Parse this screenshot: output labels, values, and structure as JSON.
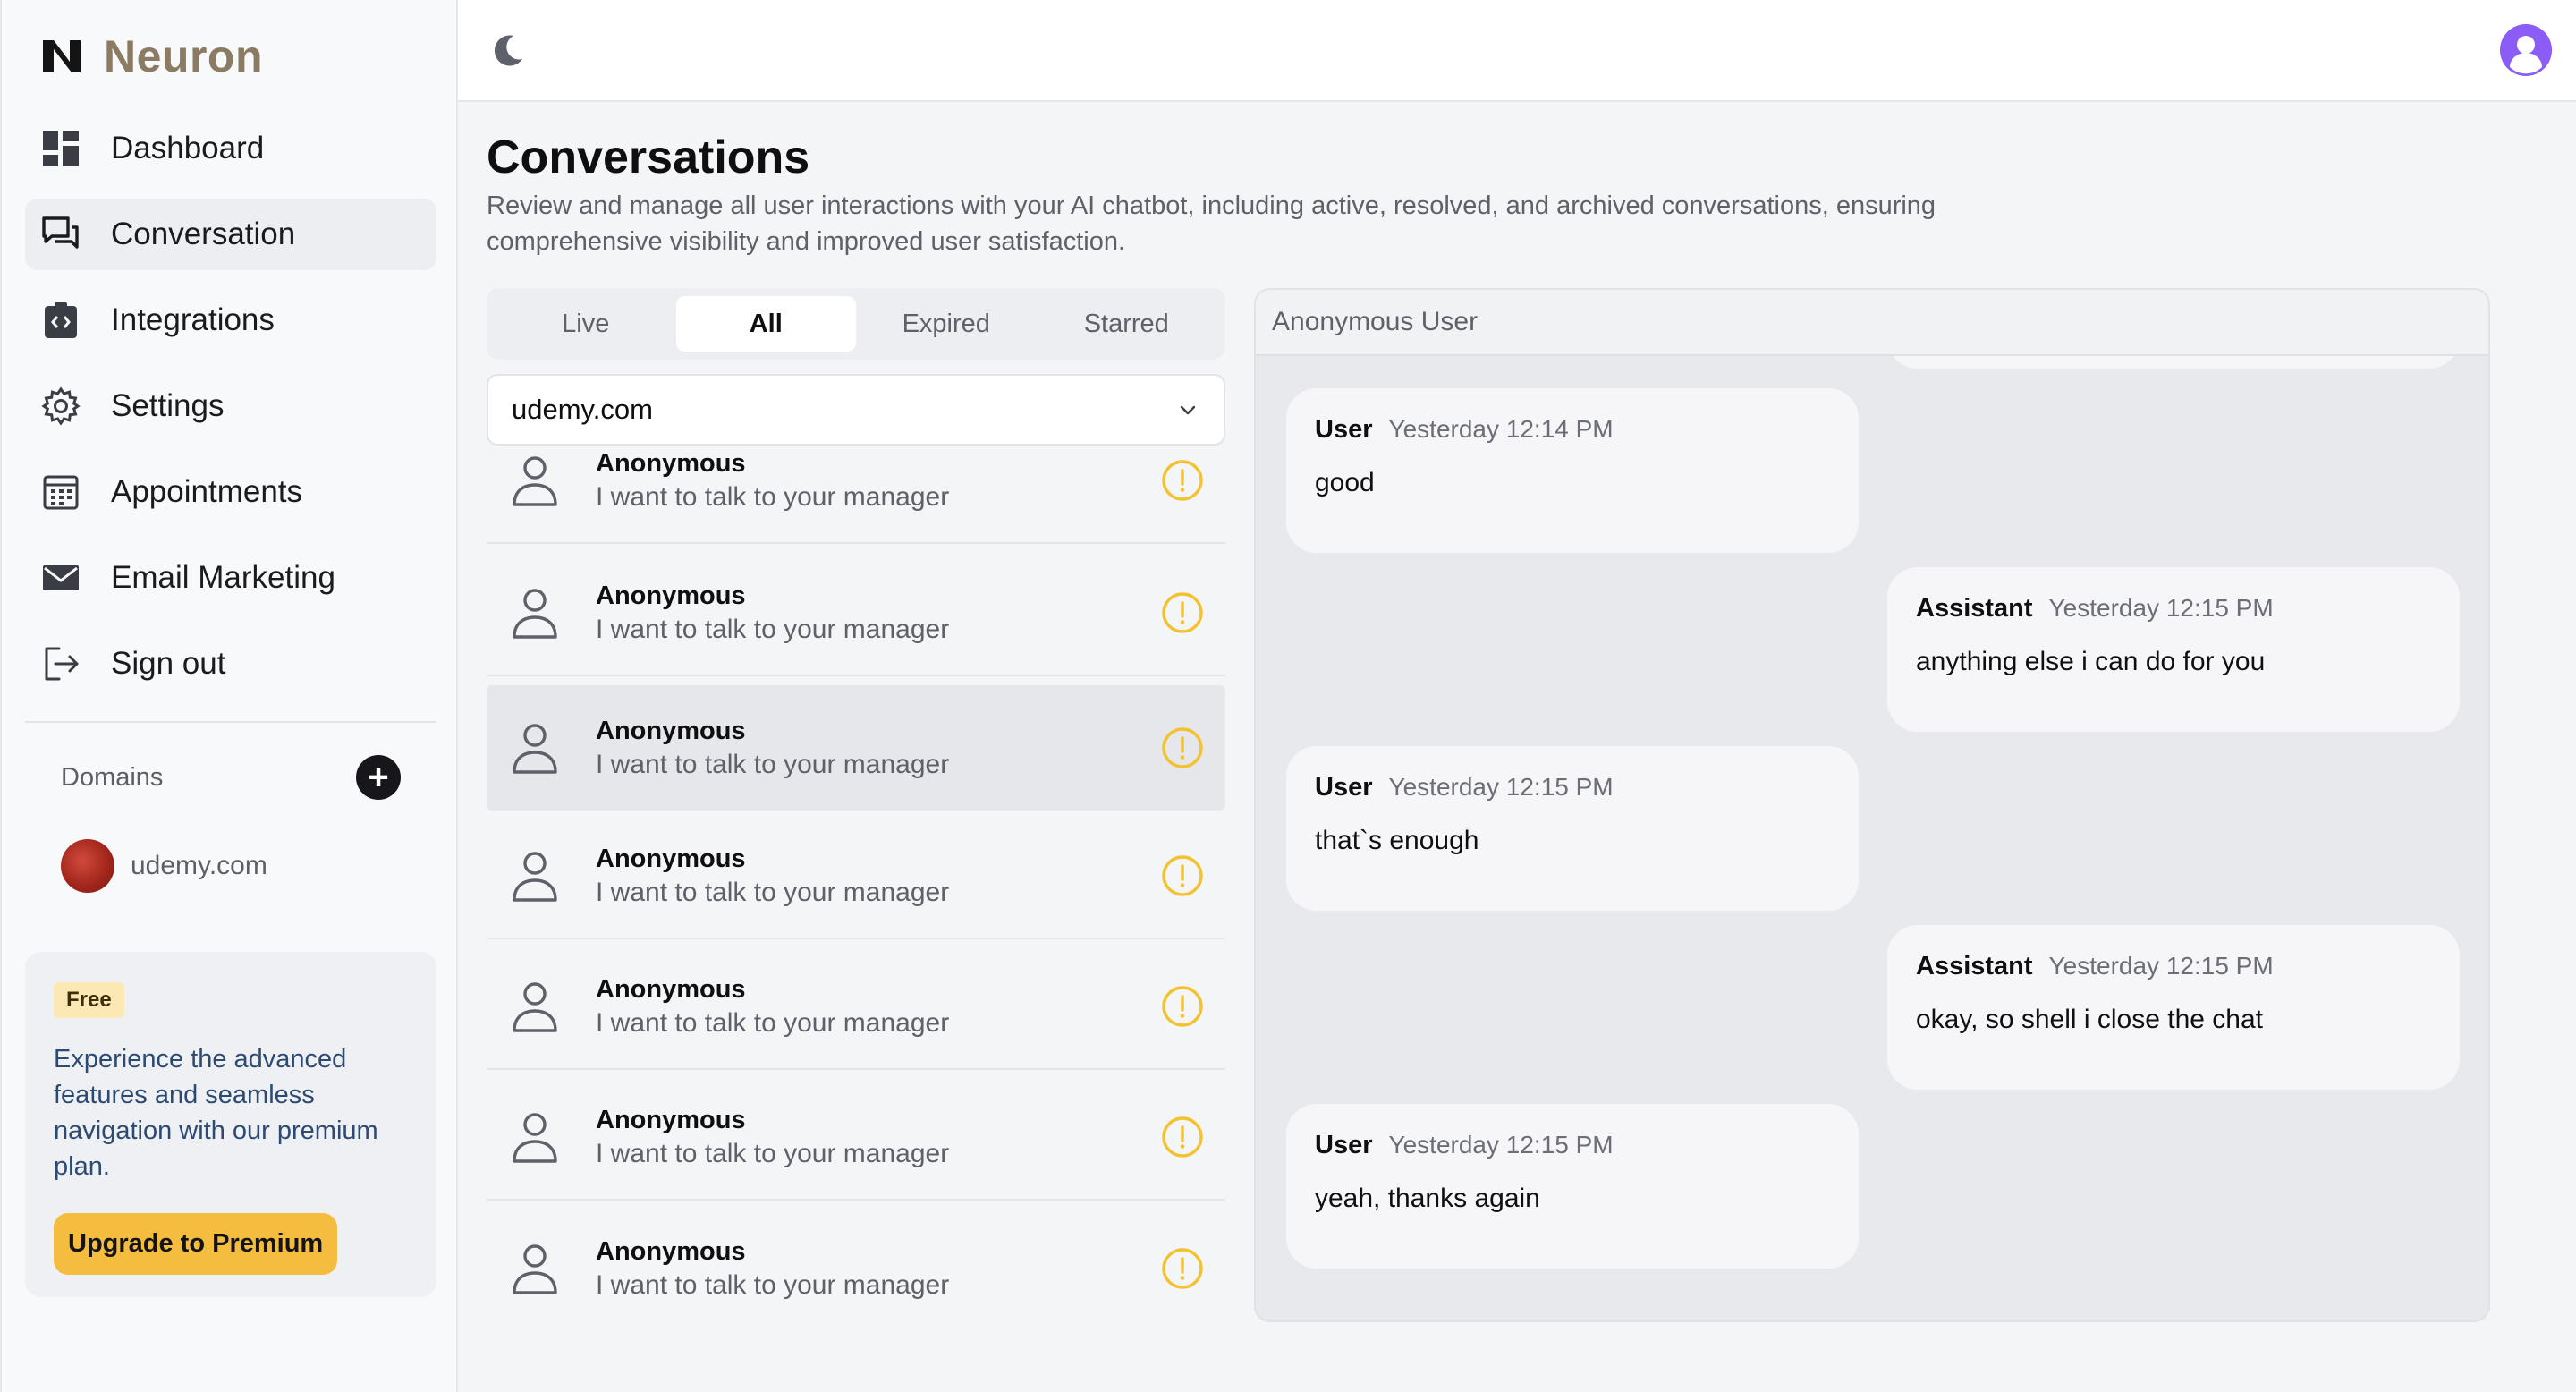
{
  "app": {
    "name": "Neuron"
  },
  "sidebar": {
    "items": [
      {
        "label": "Dashboard",
        "icon": "dashboard-icon",
        "active": false
      },
      {
        "label": "Conversation",
        "icon": "conversation-icon",
        "active": true
      },
      {
        "label": "Integrations",
        "icon": "integrations-icon",
        "active": false
      },
      {
        "label": "Settings",
        "icon": "gear-icon",
        "active": false
      },
      {
        "label": "Appointments",
        "icon": "calendar-icon",
        "active": false
      },
      {
        "label": "Email Marketing",
        "icon": "mail-icon",
        "active": false
      },
      {
        "label": "Sign out",
        "icon": "sign-out-icon",
        "active": false
      }
    ],
    "domains_label": "Domains",
    "add_symbol": "+",
    "domains": [
      {
        "name": "udemy.com"
      }
    ],
    "promo": {
      "badge": "Free",
      "text": "Experience the advanced features and seamless navigation with our premium plan.",
      "button": "Upgrade to Premium"
    }
  },
  "main": {
    "title": "Conversations",
    "description": "Review and manage all user interactions with your AI chatbot, including active, resolved, and archived conversations, ensuring comprehensive visibility and improved user satisfaction.",
    "tabs": [
      {
        "label": "Live",
        "active": false
      },
      {
        "label": "All",
        "active": true
      },
      {
        "label": "Expired",
        "active": false
      },
      {
        "label": "Starred",
        "active": false
      }
    ],
    "domain_select": {
      "value": "udemy.com"
    },
    "conversations": [
      {
        "name": "Anonymous",
        "message": "I want to talk to your manager",
        "selected": false
      },
      {
        "name": "Anonymous",
        "message": "I want to talk to your manager",
        "selected": false
      },
      {
        "name": "Anonymous",
        "message": "I want to talk to your manager",
        "selected": true
      },
      {
        "name": "Anonymous",
        "message": "I want to talk to your manager",
        "selected": false
      },
      {
        "name": "Anonymous",
        "message": "I want to talk to your manager",
        "selected": false
      },
      {
        "name": "Anonymous",
        "message": "I want to talk to your manager",
        "selected": false
      },
      {
        "name": "Anonymous",
        "message": "I want to talk to your manager",
        "selected": false
      }
    ]
  },
  "chat": {
    "title": "Anonymous User",
    "messages": [
      {
        "role": "User",
        "time": "Yesterday 12:14 PM",
        "text": "good",
        "side": "left"
      },
      {
        "role": "Assistant",
        "time": "Yesterday 12:15 PM",
        "text": "anything else i can do for you",
        "side": "right"
      },
      {
        "role": "User",
        "time": "Yesterday 12:15 PM",
        "text": "that`s enough",
        "side": "left"
      },
      {
        "role": "Assistant",
        "time": "Yesterday 12:15 PM",
        "text": "okay, so shell i close the chat",
        "side": "right"
      },
      {
        "role": "User",
        "time": "Yesterday 12:15 PM",
        "text": "yeah, thanks again",
        "side": "left"
      }
    ]
  },
  "colors": {
    "brand": "#8c7b63",
    "accent_yellow": "#f4bd40",
    "alert_icon": "#f2c230",
    "avatar_purple": "#8b5cf6"
  }
}
